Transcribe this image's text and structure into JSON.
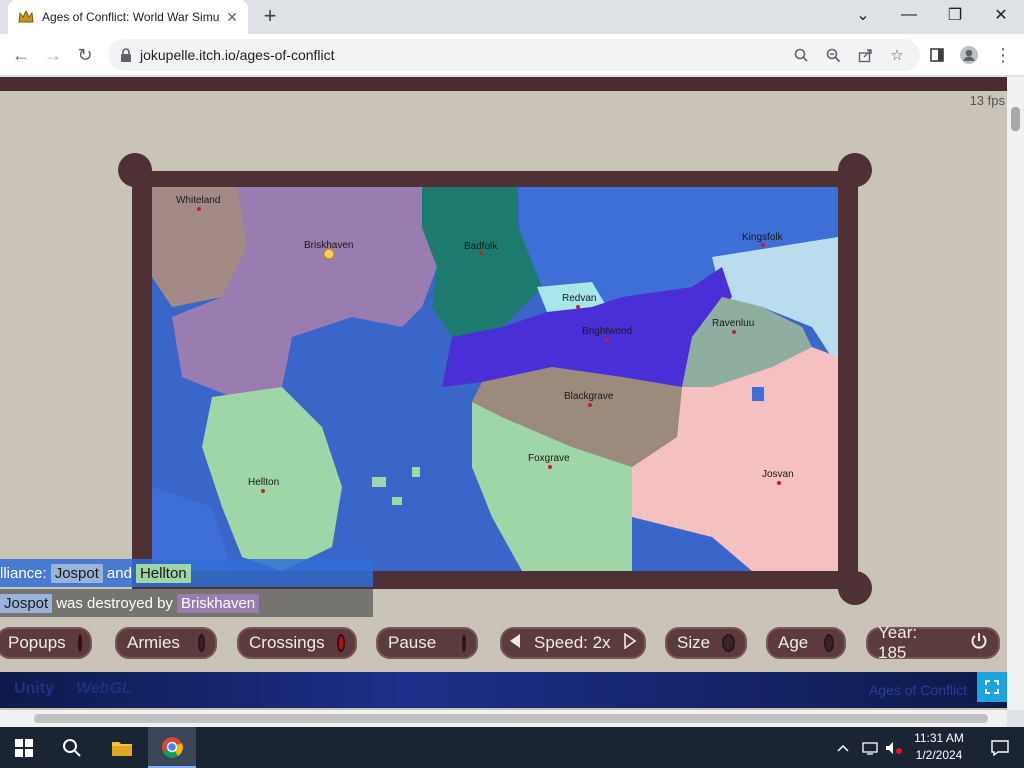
{
  "browser": {
    "tab_title": "Ages of Conflict: World War Simu",
    "url": "jokupelle.itch.io/ages-of-conflict"
  },
  "game": {
    "fps": "13 fps",
    "cities": [
      {
        "name": "Whiteland"
      },
      {
        "name": "Briskhaven"
      },
      {
        "name": "Badfolk"
      },
      {
        "name": "Kingsfolk"
      },
      {
        "name": "Redvan"
      },
      {
        "name": "Brightwood"
      },
      {
        "name": "Ravenluu"
      },
      {
        "name": "Blackgrave"
      },
      {
        "name": "Foxgrave"
      },
      {
        "name": "Hellton"
      },
      {
        "name": "Josvan"
      }
    ],
    "messages": {
      "alliance_prefix": "lliance:",
      "alliance_a": "Jospot",
      "alliance_and": "and",
      "alliance_b": "Hellton",
      "destroyed_a": "Jospot",
      "destroyed_mid": "was destroyed by",
      "destroyed_b": "Briskhaven"
    },
    "controls": {
      "popups": "Popups",
      "armies": "Armies",
      "crossings": "Crossings",
      "pause": "Pause",
      "speed": "Speed: 2x",
      "size": "Size",
      "age": "Age",
      "year": "Year: 185"
    },
    "footer": {
      "unity": "Unity",
      "webgl": "WebGL",
      "game_name": "Ages of Conflict"
    }
  },
  "taskbar": {
    "time": "11:31 AM",
    "date": "1/2/2024"
  },
  "colors": {
    "frame": "#4e3035",
    "sea": "#3a66c9",
    "alliance_bg": "#2f6fd6",
    "destroyed_bg": "#5a5a5a"
  }
}
